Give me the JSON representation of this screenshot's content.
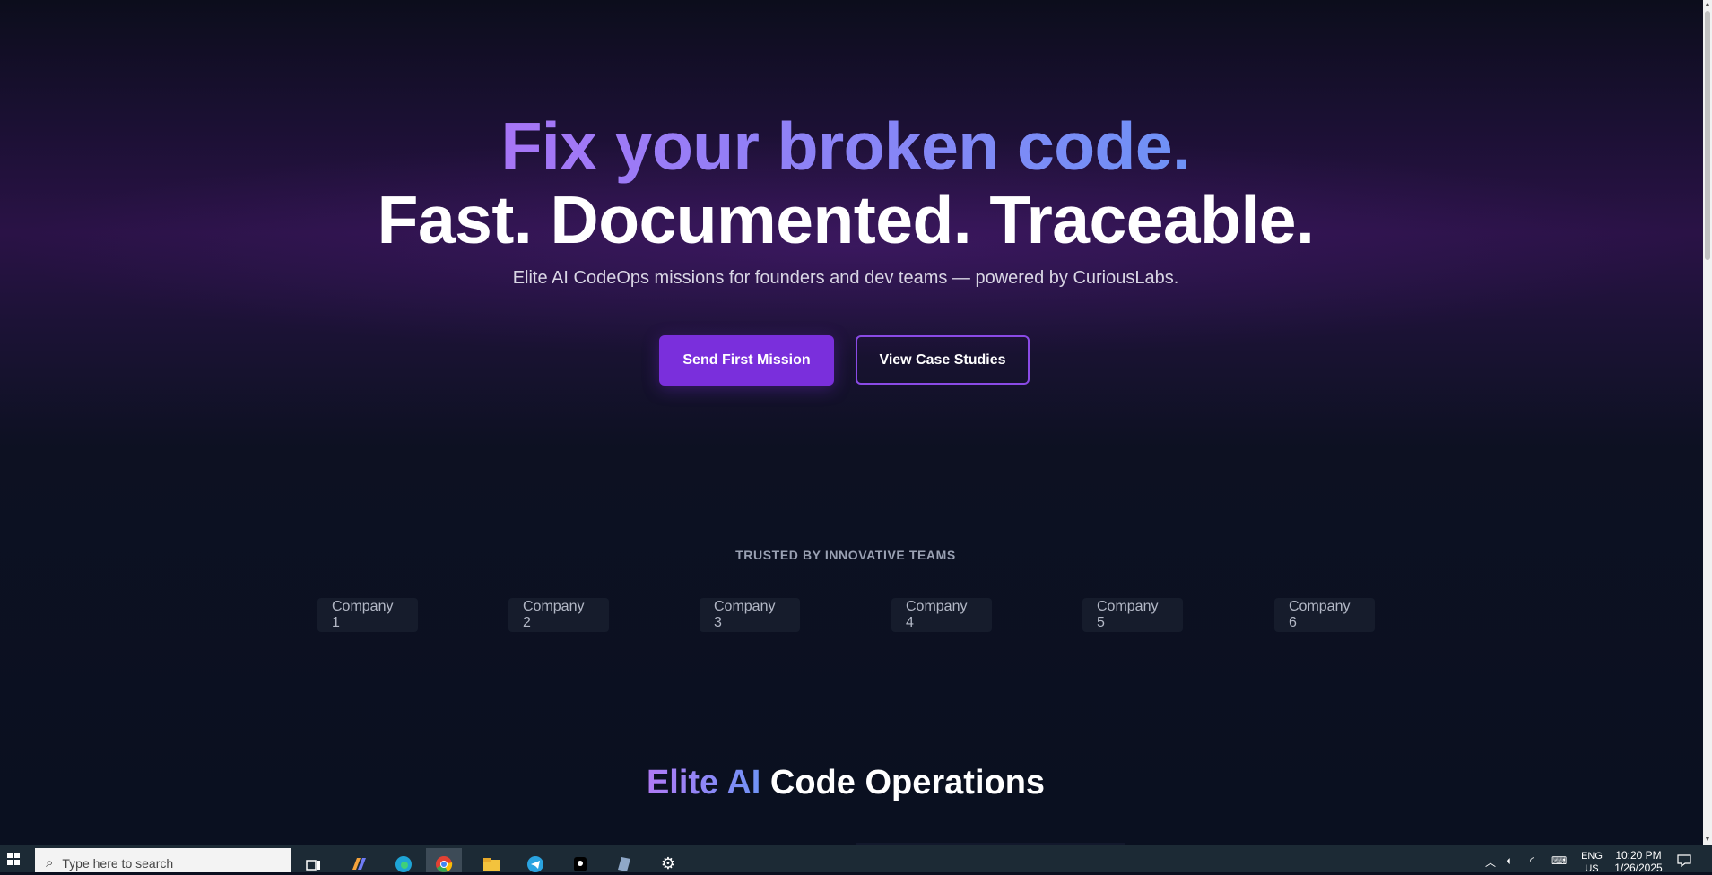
{
  "hero": {
    "headline_1": "Fix your broken code.",
    "headline_2": "Fast. Documented. Traceable.",
    "subtitle": "Elite AI CodeOps missions for founders and dev teams — powered by CuriousLabs.",
    "primary_cta": "Send First Mission",
    "secondary_cta": "View Case Studies"
  },
  "trusted": {
    "label": "TRUSTED BY INNOVATIVE TEAMS",
    "logos": [
      "Company 1",
      "Company 2",
      "Company 3",
      "Company 4",
      "Company 5",
      "Company 6"
    ]
  },
  "section": {
    "title_accent": "Elite AI",
    "title_rest": "Code Operations"
  },
  "taskbar": {
    "search_placeholder": "Type here to search",
    "language": "ENG",
    "language_region": "US",
    "time": "10:20 PM",
    "date": "1/26/2025",
    "apps": [
      "task-view",
      "copilot",
      "edge",
      "chrome",
      "file-explorer",
      "telegram",
      "app-black",
      "app-notes",
      "settings"
    ]
  },
  "colors": {
    "accent_purple": "#7a2fdc",
    "gradient_start": "#a374f5",
    "gradient_end": "#6b93f7",
    "page_bg": "#0b0f1f"
  }
}
